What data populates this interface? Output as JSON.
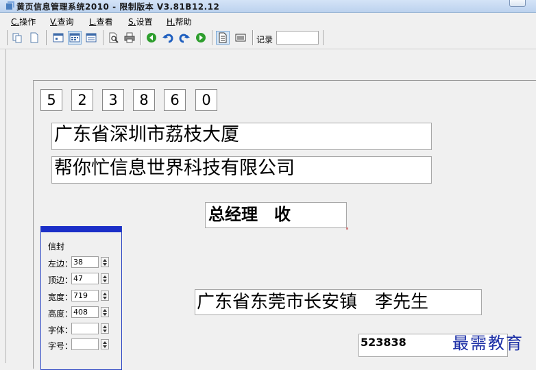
{
  "window": {
    "title": "黄页信息管理系统2010 - 限制版本 V3.81B12.12"
  },
  "menu": [
    {
      "key": "C.",
      "label": "操作"
    },
    {
      "key": "V.",
      "label": "查询"
    },
    {
      "key": "L.",
      "label": "查看"
    },
    {
      "key": "S.",
      "label": "设置"
    },
    {
      "key": "H.",
      "label": "帮助"
    }
  ],
  "toolbar": {
    "icons": [
      "copy-icon",
      "new-page-icon",
      "layout-one-icon",
      "layout-grid-icon",
      "layout-list-icon",
      "preview-icon",
      "print-icon",
      "back-icon",
      "undo-icon",
      "redo-icon",
      "forward-icon",
      "document-icon",
      "list-view-icon"
    ],
    "record_label": "记录",
    "record_value": ""
  },
  "envelope": {
    "zip_digits": [
      "5",
      "2",
      "3",
      "8",
      "6",
      "0"
    ],
    "address_line1": "广东省深圳市荔枝大厦",
    "address_line2": "帮你忙信息世界科技有限公司",
    "recipient": "总经理　收",
    "sender": "广东省东莞市长安镇　李先生",
    "sender_zip": "523838"
  },
  "settings_panel": {
    "title": "信封",
    "fields": [
      {
        "label": "左边：",
        "value": "38"
      },
      {
        "label": "顶边：",
        "value": "47"
      },
      {
        "label": "宽度：",
        "value": "719"
      },
      {
        "label": "高度：",
        "value": "408"
      },
      {
        "label": "字体：",
        "value": ""
      },
      {
        "label": "字号：",
        "value": ""
      }
    ]
  },
  "watermark": "最需教育",
  "colors": {
    "panel_accent": "#1b2fc8",
    "watermark": "#1c2fa6",
    "go_green": "#2e9e2e",
    "arrow_blue": "#1f5fbf"
  }
}
